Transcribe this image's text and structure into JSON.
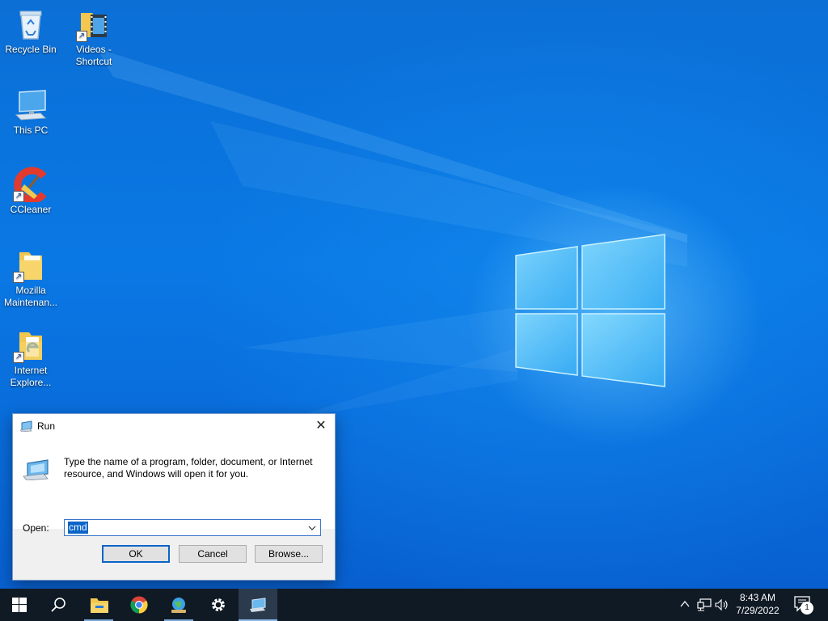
{
  "desktop": {
    "icons": [
      {
        "name": "recycle-bin",
        "label": "Recycle Bin"
      },
      {
        "name": "videos-shortcut",
        "label": "Videos - Shortcut"
      },
      {
        "name": "this-pc",
        "label": "This PC"
      },
      {
        "name": "ccleaner",
        "label": "CCleaner"
      },
      {
        "name": "mozilla-maintenance",
        "label": "Mozilla Maintenan..."
      },
      {
        "name": "internet-explorer",
        "label": "Internet Explore..."
      }
    ]
  },
  "run_dialog": {
    "title": "Run",
    "close_glyph": "✕",
    "description": "Type the name of a program, folder, document, or Internet resource, and Windows will open it for you.",
    "open_label": "Open:",
    "open_value": "cmd",
    "ok_label": "OK",
    "cancel_label": "Cancel",
    "browse_label": "Browse..."
  },
  "taskbar": {
    "items": [
      "start-icon",
      "search-icon",
      "file-explorer-icon",
      "chrome-icon",
      "network-globe-icon",
      "settings-gear-icon",
      "run-app-icon"
    ],
    "clock_time": "8:43 AM",
    "clock_date": "7/29/2022",
    "notification_count": "1"
  },
  "colors": {
    "desktop_blue": "#0a78e4",
    "taskbar": "#101a25",
    "accent": "#0a64c8"
  }
}
